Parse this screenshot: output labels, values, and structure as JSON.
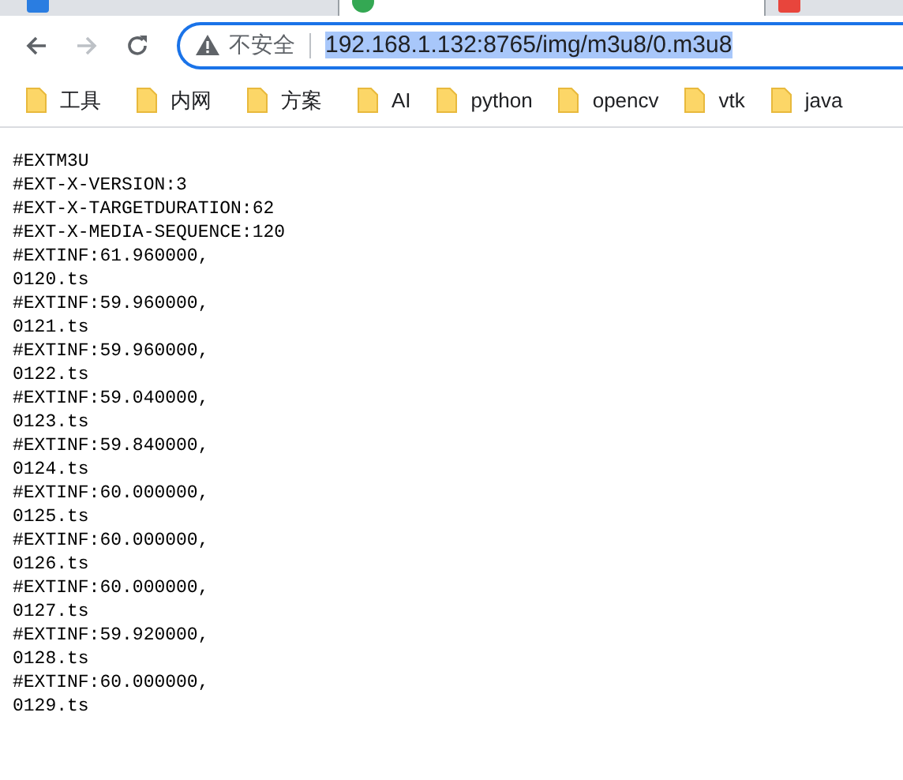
{
  "nav_buttons": [
    {
      "kind": "back",
      "disabled": false
    },
    {
      "kind": "forward",
      "disabled": true
    },
    {
      "kind": "reload",
      "disabled": false
    }
  ],
  "address_bar": {
    "security_label": "不安全",
    "url": "192.168.1.132:8765/img/m3u8/0.m3u8",
    "url_selected": true
  },
  "bookmarks": [
    "工具",
    "内网",
    "方案",
    "AI",
    "python",
    "opencv",
    "vtk",
    "java"
  ],
  "content_lines": [
    "#EXTM3U",
    "#EXT-X-VERSION:3",
    "#EXT-X-TARGETDURATION:62",
    "#EXT-X-MEDIA-SEQUENCE:120",
    "#EXTINF:61.960000,",
    "0120.ts",
    "#EXTINF:59.960000,",
    "0121.ts",
    "#EXTINF:59.960000,",
    "0122.ts",
    "#EXTINF:59.040000,",
    "0123.ts",
    "#EXTINF:59.840000,",
    "0124.ts",
    "#EXTINF:60.000000,",
    "0125.ts",
    "#EXTINF:60.000000,",
    "0126.ts",
    "#EXTINF:60.000000,",
    "0127.ts",
    "#EXTINF:59.920000,",
    "0128.ts",
    "#EXTINF:60.000000,",
    "0129.ts"
  ]
}
